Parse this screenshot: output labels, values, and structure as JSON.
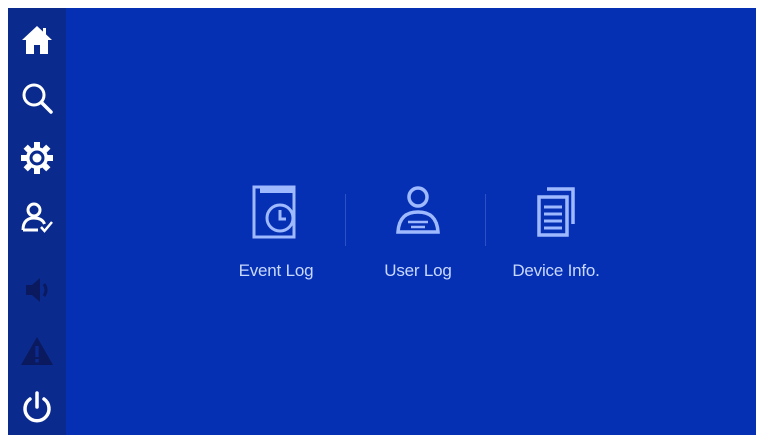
{
  "sidebar": {
    "items": [
      {
        "icon": "home-icon"
      },
      {
        "icon": "search-icon"
      },
      {
        "icon": "gear-icon"
      },
      {
        "icon": "user-check-icon"
      },
      {
        "icon": "speaker-icon"
      },
      {
        "icon": "warning-icon"
      },
      {
        "icon": "power-icon"
      }
    ]
  },
  "main": {
    "items": [
      {
        "label": "Event Log",
        "icon": "event-log-icon"
      },
      {
        "label": "User Log",
        "icon": "user-log-icon"
      },
      {
        "label": "Device Info.",
        "icon": "device-info-icon"
      }
    ]
  },
  "colors": {
    "background": "#0530b4",
    "sidebar": "#0a2a8e",
    "icon": "#ffffff",
    "main_icon": "#9fb9ff",
    "label": "#c9d8ff",
    "muted_icon": "#0b1a5e"
  }
}
